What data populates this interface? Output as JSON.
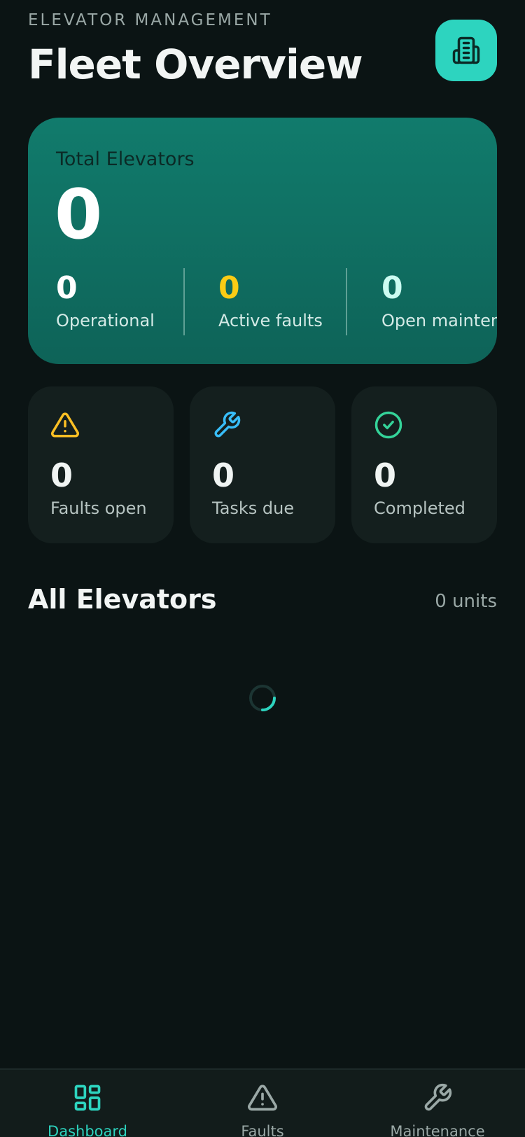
{
  "header": {
    "subtitle": "ELEVATOR MANAGEMENT",
    "title": "Fleet Overview",
    "action_icon": "building-icon"
  },
  "summary": {
    "label": "Total Elevators",
    "total": "0",
    "stats": [
      {
        "value": "0",
        "label": "Operational",
        "color": "#ffffff"
      },
      {
        "value": "0",
        "label": "Active faults",
        "color": "#facc15"
      },
      {
        "value": "0",
        "label": "Open maintenance",
        "color": "#ccfbf1"
      }
    ]
  },
  "cards": [
    {
      "icon": "warning-icon",
      "value": "0",
      "label": "Faults open",
      "color": "#fbbf24"
    },
    {
      "icon": "wrench-icon",
      "value": "0",
      "label": "Tasks due",
      "color": "#38bdf8"
    },
    {
      "icon": "check-circle-icon",
      "value": "0",
      "label": "Completed",
      "color": "#34d399"
    }
  ],
  "section": {
    "title": "All Elevators",
    "count": "0 units"
  },
  "nav": [
    {
      "label": "Dashboard",
      "icon": "dashboard-icon",
      "active": true
    },
    {
      "label": "Faults",
      "icon": "warning-icon",
      "active": false
    },
    {
      "label": "Maintenance",
      "icon": "wrench-icon",
      "active": false
    }
  ],
  "colors": {
    "accent": "#2dd4bf",
    "background": "#0b1414",
    "nav_inactive": "#9aa8a6"
  }
}
